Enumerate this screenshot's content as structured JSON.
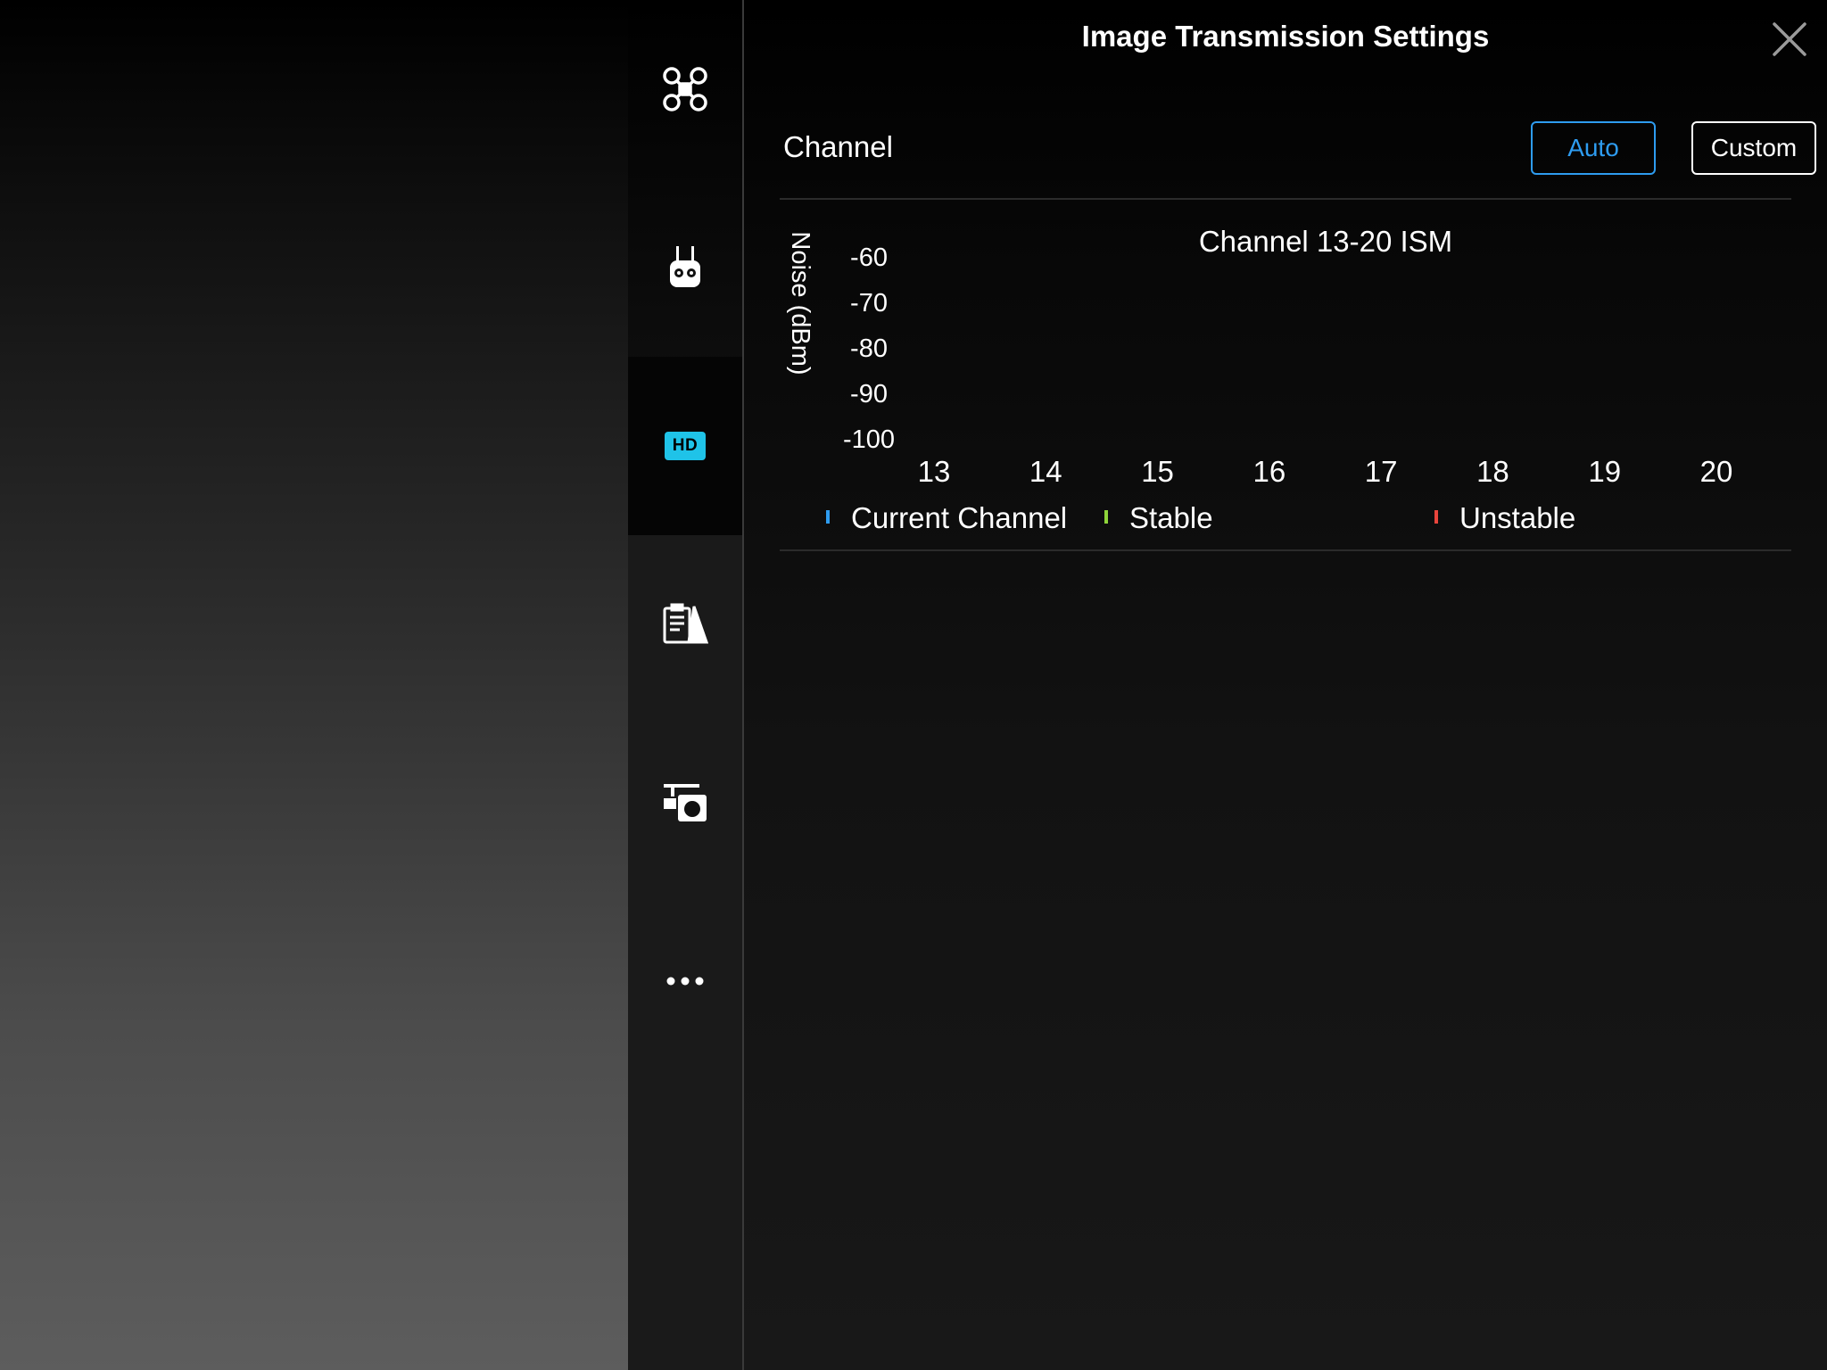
{
  "window": {
    "title": "Image Transmission Settings"
  },
  "sidebar": {
    "items": [
      {
        "icon": "aircraft-icon"
      },
      {
        "icon": "remote-controller-icon"
      },
      {
        "icon": "hd-icon",
        "label": "HD",
        "active": true,
        "accent": "#1fc3e8"
      },
      {
        "icon": "flight-checklist-icon"
      },
      {
        "icon": "gimbal-camera-icon"
      },
      {
        "icon": "more-icon"
      }
    ]
  },
  "channel": {
    "label": "Channel",
    "modes": [
      {
        "label": "Auto",
        "selected": true,
        "color": "#2e9cf0"
      },
      {
        "label": "Custom",
        "selected": false,
        "color": "#ffffff"
      }
    ]
  },
  "chart_data": {
    "type": "bar",
    "title": "Channel 13-20 ISM",
    "ylabel": "Noise (dBm)",
    "y_ticks": [
      "-60",
      "-70",
      "-80",
      "-90",
      "-100"
    ],
    "categories": [
      "13",
      "14",
      "15",
      "16",
      "17",
      "18",
      "19",
      "20"
    ],
    "legend": [
      {
        "name": "Current Channel",
        "color": "#2e9cf0"
      },
      {
        "name": "Stable",
        "color": "#8ed43a"
      },
      {
        "name": "Unstable",
        "color": "#e8453c"
      }
    ]
  }
}
